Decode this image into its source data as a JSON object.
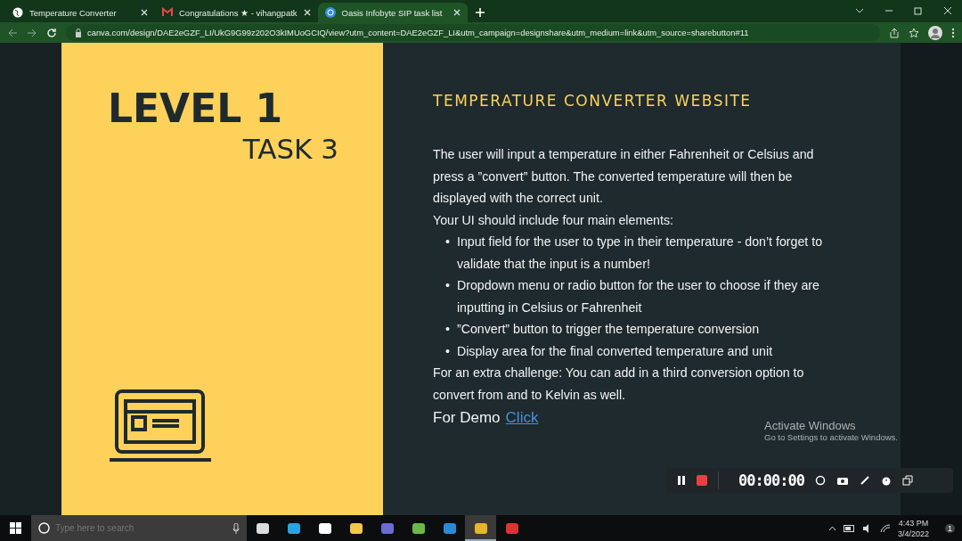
{
  "browser": {
    "tabs": [
      {
        "title": "Temperature Converter",
        "selected": false
      },
      {
        "title": "Congratulations ★ - vihangpatk",
        "selected": false
      },
      {
        "title": "Oasis Infobyte SIP task list",
        "selected": true
      }
    ],
    "url": "canva.com/design/DAE2eGZF_LI/UkG9G99z202O3kIMUoGCIQ/view?utm_content=DAE2eGZF_LI&utm_campaign=designshare&utm_medium=link&utm_source=sharebutton#11"
  },
  "slide": {
    "level": "LEVEL 1",
    "task": "TASK 3",
    "heading": "TEMPERATURE CONVERTER WEBSITE",
    "paragraphs": [
      "The user will input a temperature in either Fahrenheit or Celsius and press a ”convert” button. The converted temperature will then be displayed with the correct unit.",
      "Your UI should include four main elements:"
    ],
    "bullet_marker": "•",
    "bullets": [
      "Input field for the user to type in their temperature - don’t forget to validate that the input is a number!",
      "Dropdown menu or radio button for the user to choose if they are inputting in Celsius or Fahrenheit",
      "”Convert” button to trigger the temperature conversion",
      "Display area for the final converted temperature and unit"
    ],
    "closing": "For an extra challenge: You can add in a third conversion option to convert from and to Kelvin as well.",
    "demo_label": "For Demo",
    "demo_link": "Click"
  },
  "recorder": {
    "timer": "00:00:00"
  },
  "activation": {
    "title": "Activate Windows",
    "subtitle": "Go to Settings to activate Windows."
  },
  "taskbar": {
    "search_placeholder": "Type here to search",
    "apps": [
      {
        "selected": false
      },
      {
        "selected": false
      },
      {
        "selected": false
      },
      {
        "selected": false
      },
      {
        "selected": false
      },
      {
        "selected": false
      },
      {
        "selected": false
      },
      {
        "selected": true
      },
      {
        "selected": false
      }
    ],
    "time": "4:43 PM",
    "date": "3/4/2022",
    "notifications": "1"
  }
}
